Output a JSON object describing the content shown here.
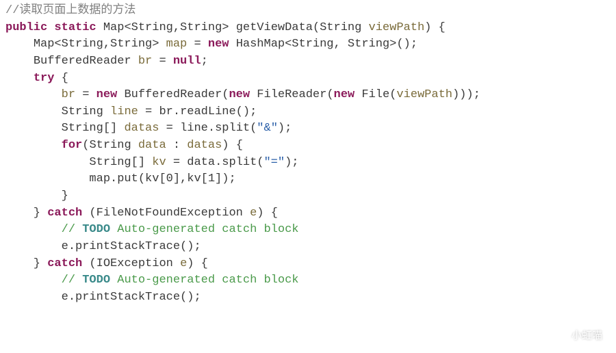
{
  "code": {
    "cmt_top": "//读取页面上数据的方法",
    "kw_public": "public",
    "kw_static": "static",
    "ret_type": "Map<String,String>",
    "fn_name": "getViewData",
    "param_type": "String",
    "param_name": "viewPath",
    "decl_map_type": "Map<String,String>",
    "decl_map_var": "map",
    "kw_new1": "new",
    "hashmap": "HashMap<String, String>()",
    "decl_br_type": "BufferedReader",
    "decl_br_var": "br",
    "kw_null": "null",
    "kw_try": "try",
    "assign_br": "br",
    "kw_new2": "new",
    "cls_bufreader": "BufferedReader",
    "kw_new3": "new",
    "cls_filereader": "FileReader",
    "kw_new4": "new",
    "cls_file": "File",
    "arg_viewpath": "viewPath",
    "decl_line_type": "String",
    "decl_line_var": "line",
    "expr_readline": "br.readLine()",
    "decl_datas_type": "String[]",
    "decl_datas_var": "datas",
    "expr_split_lhs": "line.split(",
    "str_amp": "\"&\"",
    "kw_for": "for",
    "for_type": "String",
    "for_var": "data",
    "for_iter": "datas",
    "decl_kv_type": "String[]",
    "decl_kv_var": "kv",
    "expr_kv_lhs": "data.split(",
    "str_eq": "\"=\"",
    "expr_put": "map.put(kv[0],kv[1]);",
    "kw_catch1": "catch",
    "catch1_type": "FileNotFoundException",
    "catch1_var": "e",
    "cmt_todo_prefix": "// ",
    "cmt_todo_kw": "TODO",
    "cmt_todo_rest": " Auto-generated catch block",
    "expr_trace": "e.printStackTrace();",
    "kw_catch2": "catch",
    "catch2_type": "IOException",
    "catch2_var": "e"
  },
  "watermark": {
    "text": "小虹喵"
  }
}
